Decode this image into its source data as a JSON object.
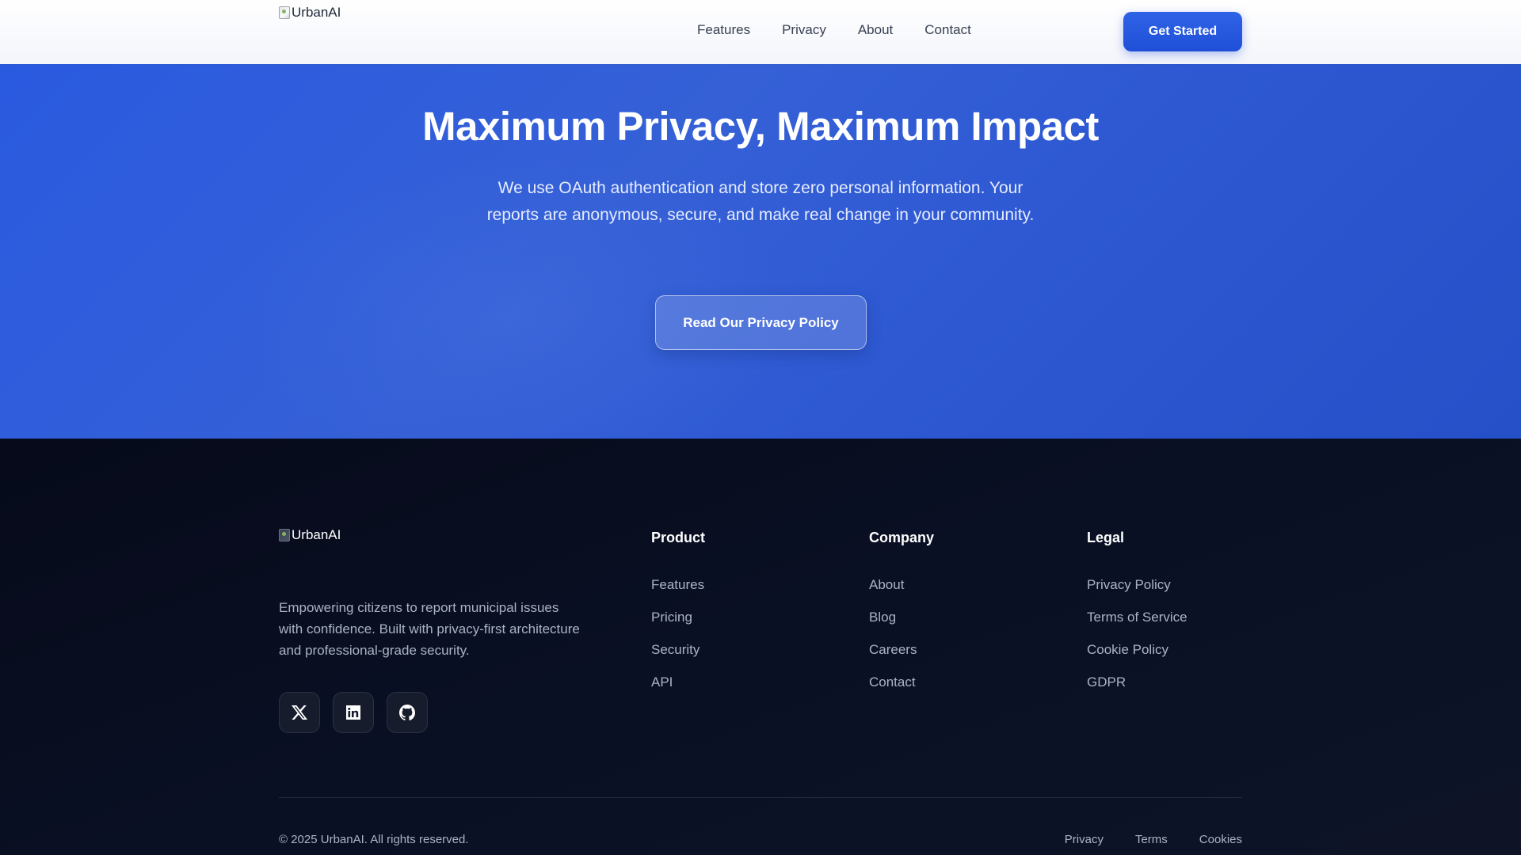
{
  "header": {
    "logo_alt": "UrbanAI",
    "nav": [
      {
        "label": "Features"
      },
      {
        "label": "Privacy"
      },
      {
        "label": "About"
      },
      {
        "label": "Contact"
      }
    ],
    "cta_label": "Get Started"
  },
  "hero": {
    "title": "Maximum Privacy, Maximum Impact",
    "subtitle": "We use OAuth authentication and store zero personal information. Your reports are anonymous, secure, and make real change in your community.",
    "button_label": "Read Our Privacy Policy"
  },
  "footer": {
    "logo_alt": "UrbanAI",
    "description": "Empowering citizens to report municipal issues with confidence. Built with privacy-first architecture and professional-grade security.",
    "socials": [
      {
        "icon": "x-icon"
      },
      {
        "icon": "linkedin-icon"
      },
      {
        "icon": "github-icon"
      }
    ],
    "columns": [
      {
        "title": "Product",
        "links": [
          "Features",
          "Pricing",
          "Security",
          "API"
        ]
      },
      {
        "title": "Company",
        "links": [
          "About",
          "Blog",
          "Careers",
          "Contact"
        ]
      },
      {
        "title": "Legal",
        "links": [
          "Privacy Policy",
          "Terms of Service",
          "Cookie Policy",
          "GDPR"
        ]
      }
    ],
    "copyright": "© 2025 UrbanAI. All rights reserved.",
    "bottom_links": [
      "Privacy",
      "Terms",
      "Cookies"
    ]
  },
  "colors": {
    "brand_blue": "#2563eb",
    "hero_bg": "#2d5ad6",
    "footer_bg": "#0a1024"
  }
}
